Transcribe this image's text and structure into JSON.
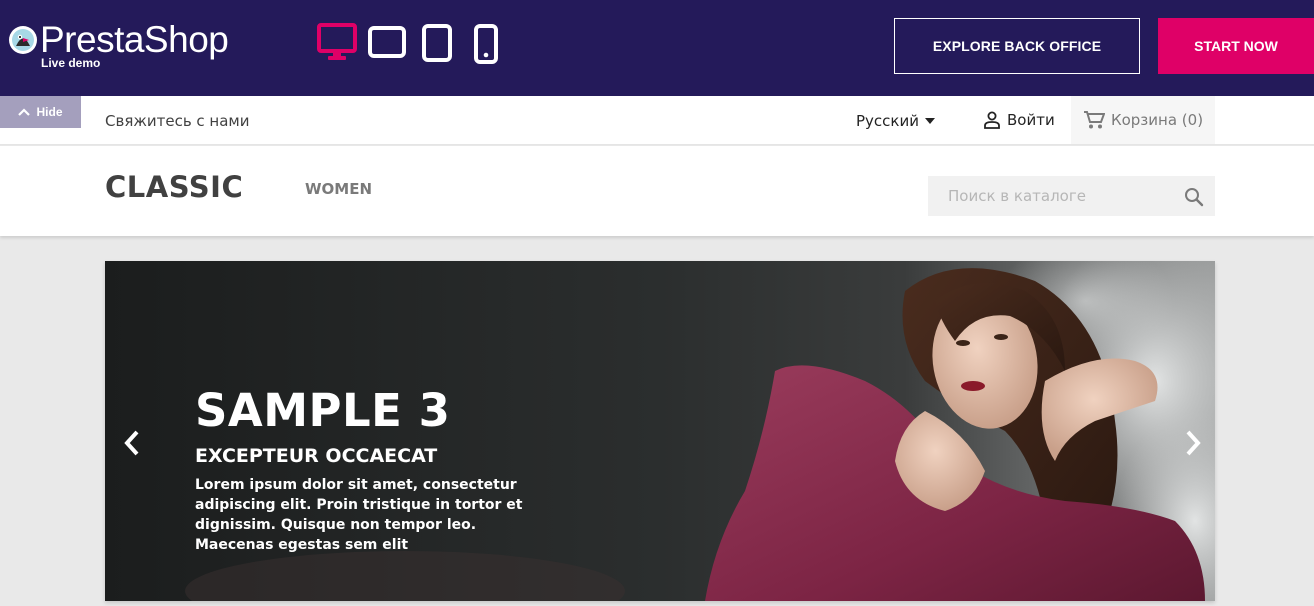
{
  "demo_bar": {
    "brand": "PrestaShop",
    "subtitle": "Live demo",
    "devices": [
      "desktop-icon",
      "tablet-landscape-icon",
      "tablet-portrait-icon",
      "mobile-icon"
    ],
    "active_device": "desktop-icon",
    "explore_label": "EXPLORE BACK OFFICE",
    "start_label": "START NOW",
    "colors": {
      "bar": "#241a5a",
      "accent": "#df0067"
    }
  },
  "nav": {
    "hide_label": "Hide",
    "contact_label": "Свяжитесь с нами",
    "language": "Русский",
    "login_label": "Войти",
    "cart_label": "Корзина (0)"
  },
  "header": {
    "logo": "CLASSIC",
    "menu": [
      "WOMEN"
    ],
    "search_placeholder": "Поиск в каталоге"
  },
  "slide": {
    "title": "SAMPLE 3",
    "subtitle": "EXCEPTEUR OCCAECAT",
    "description": "Lorem ipsum dolor sit amet, consectetur adipiscing elit. Proin tristique in tortor et dignissim. Quisque non tempor leo. Maecenas egestas sem elit"
  }
}
